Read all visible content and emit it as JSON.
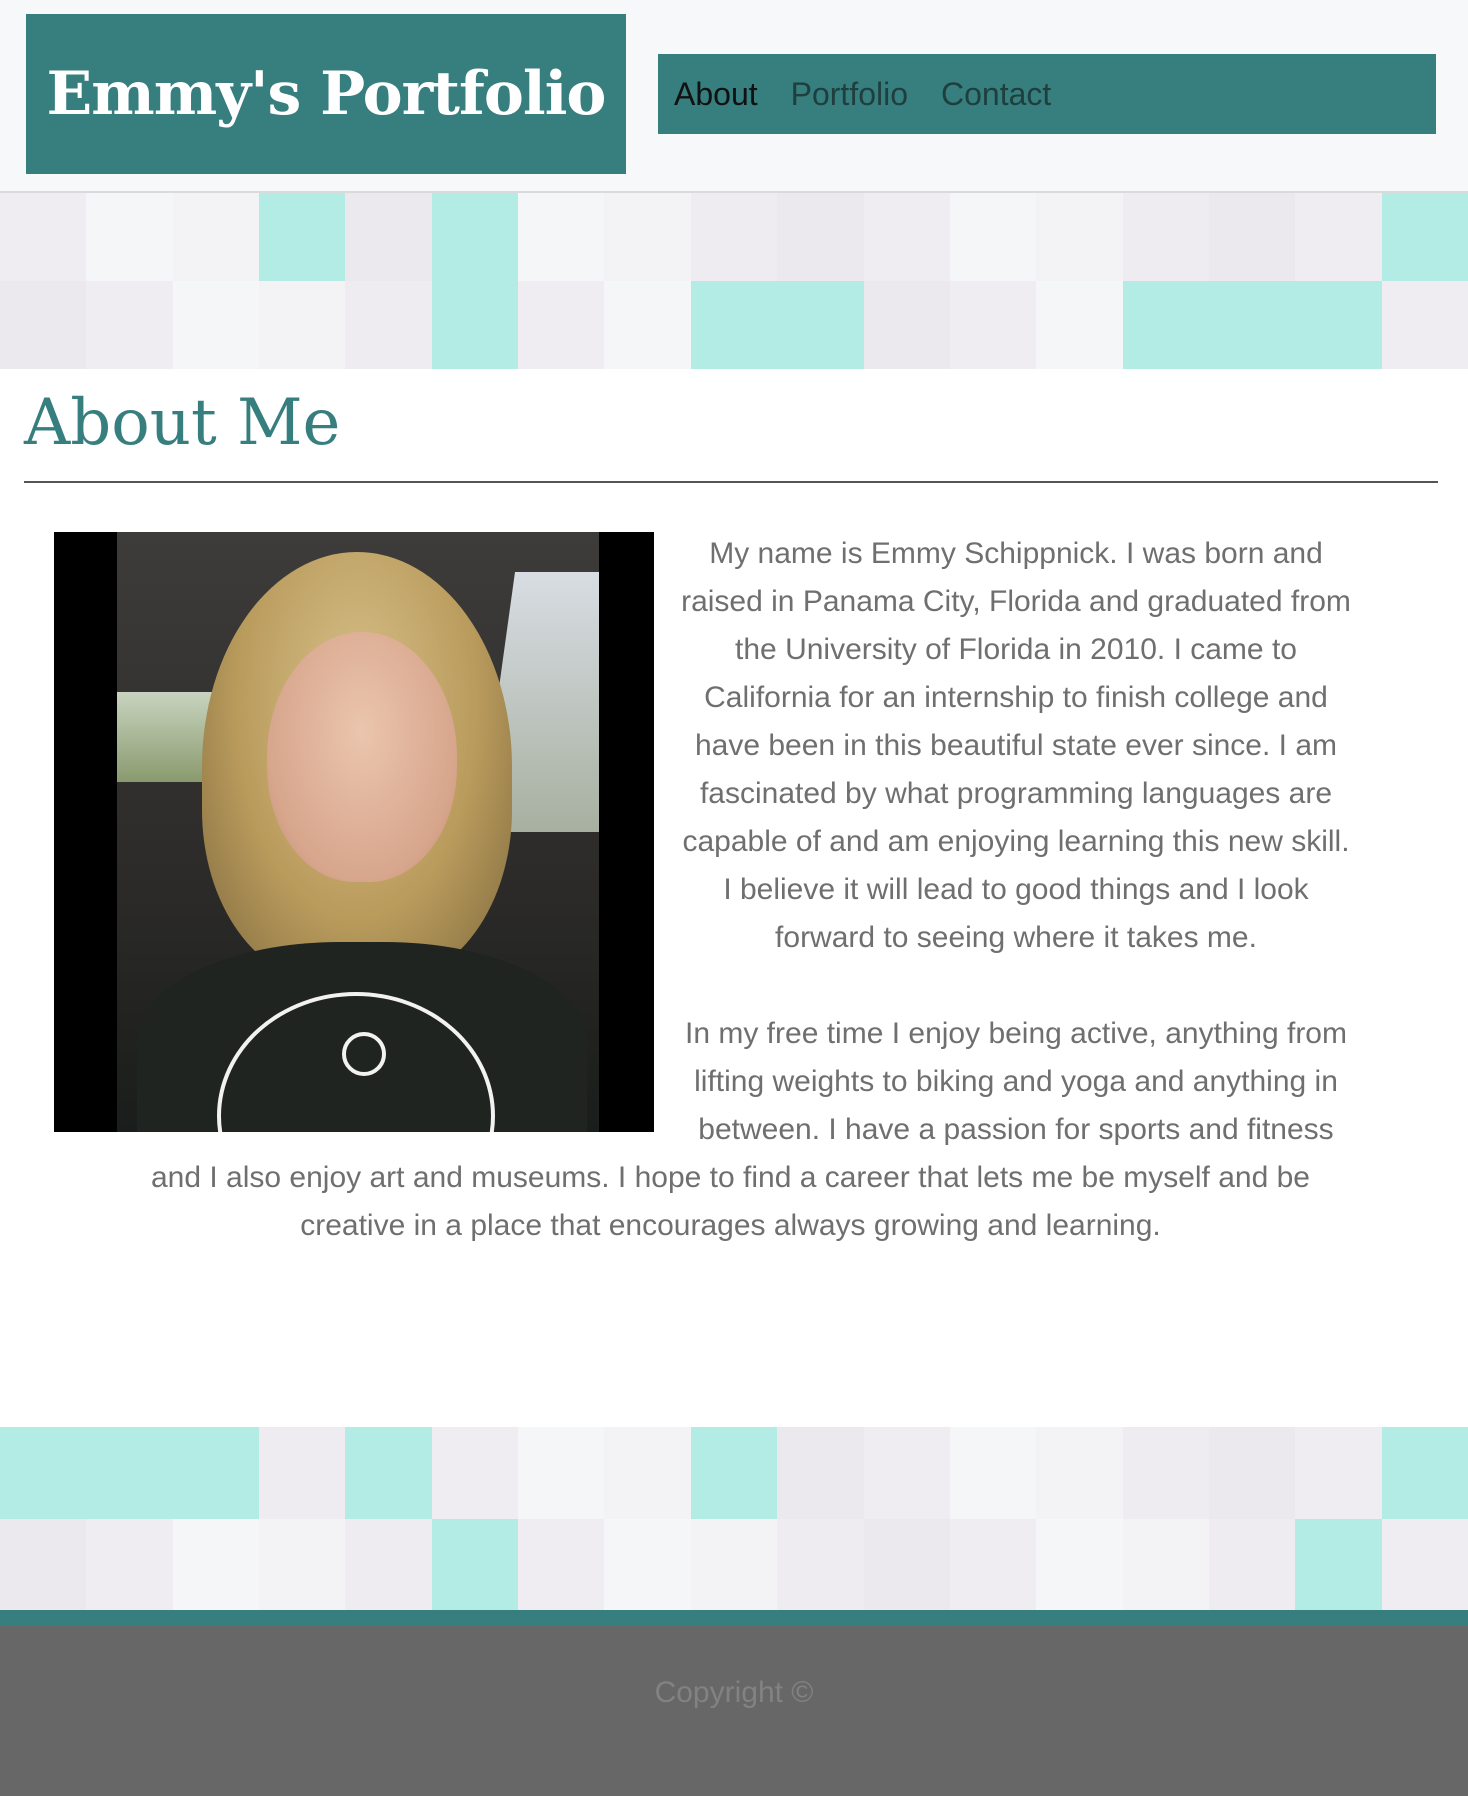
{
  "header": {
    "brand": "Emmy's Portfolio",
    "nav": [
      {
        "label": "About",
        "active": true
      },
      {
        "label": "Portfolio",
        "active": false
      },
      {
        "label": "Contact",
        "active": false
      }
    ]
  },
  "about": {
    "title": "About Me",
    "photo_alt": "Photo of Emmy",
    "paragraph1_lines": [
      "My name is Emmy Schippnick. I was born and",
      "raised in Panama City, Florida and graduated from",
      "the University of Florida in 2010. I came to",
      "California for an internship to finish college and",
      "have been in this beautiful state ever since. I am",
      "fascinated by what programming languages are",
      "capable of and am enjoying learning this new skill.",
      "I believe it will lead to good things and I look",
      "forward to seeing where it takes me."
    ],
    "paragraph2_lines": [
      "In my free time I enjoy being active, anything from",
      "lifting weights to biking and yoga and anything in",
      "between. I have a passion for sports and fitness",
      "and I also enjoy art and museums. I hope to find a career that lets me be myself and be",
      "creative in a place that encourages always growing and learning."
    ]
  },
  "footer": {
    "copyright": "Copyright ©"
  },
  "colors": {
    "accent": "#377e7f",
    "tile_mint": "#b2ece4",
    "tile_light": "#efedf1",
    "footer_bg": "#676767",
    "body_text": "#6f6f6f"
  }
}
